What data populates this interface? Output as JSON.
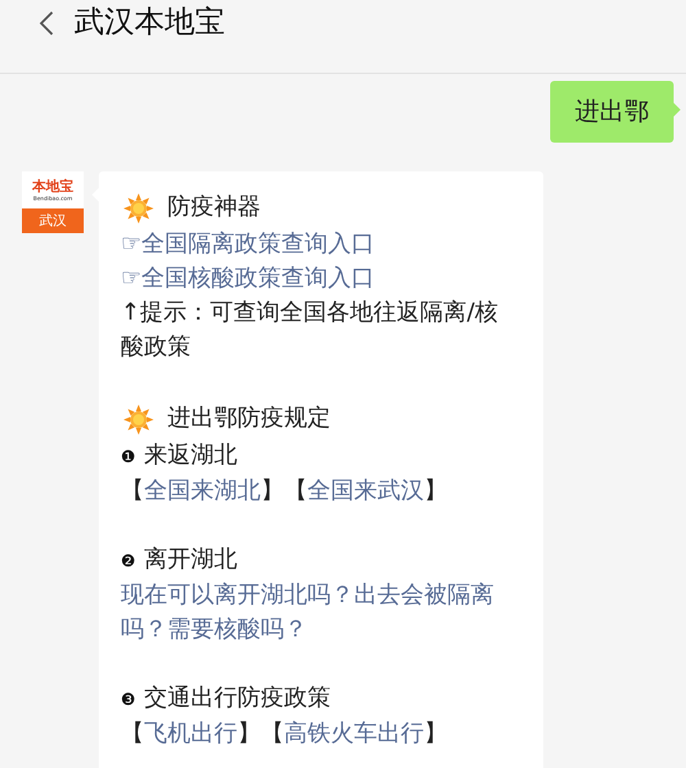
{
  "header": {
    "title": "武汉本地宝"
  },
  "messages": [
    {
      "kind": "outgoing",
      "text": "进出鄂"
    },
    {
      "kind": "incoming",
      "avatar": {
        "brand": "本地宝",
        "site": "Bendibao.com",
        "city": "武汉"
      },
      "blocks": [
        {
          "kind": "heading",
          "text": "防疫神器"
        },
        {
          "kind": "link",
          "text": "☞全国隔离政策查询入口"
        },
        {
          "kind": "link",
          "text": "☞全国核酸政策查询入口"
        },
        {
          "kind": "note",
          "text": "↑提示：可查询全国各地往返隔离/核酸政策"
        },
        {
          "kind": "spacer"
        },
        {
          "kind": "heading",
          "text": "进出鄂防疫规定"
        },
        {
          "kind": "section",
          "marker": "❶",
          "text": "来返湖北"
        },
        {
          "kind": "linkrow",
          "parts": [
            {
              "text": "【",
              "link": false
            },
            {
              "text": "全国来湖北",
              "link": true
            },
            {
              "text": "】【",
              "link": false
            },
            {
              "text": "全国来武汉",
              "link": true
            },
            {
              "text": "】",
              "link": false
            }
          ]
        },
        {
          "kind": "spacer"
        },
        {
          "kind": "section",
          "marker": "❷",
          "text": "离开湖北"
        },
        {
          "kind": "link",
          "text": "现在可以离开湖北吗？出去会被隔离吗？需要核酸吗？"
        },
        {
          "kind": "spacer"
        },
        {
          "kind": "section",
          "marker": "❸",
          "text": "交通出行防疫政策"
        },
        {
          "kind": "linkrow",
          "parts": [
            {
              "text": "【",
              "link": false
            },
            {
              "text": "飞机出行",
              "link": true
            },
            {
              "text": "】【",
              "link": false
            },
            {
              "text": "高铁火车出行",
              "link": true
            },
            {
              "text": "】",
              "link": false
            }
          ]
        }
      ]
    }
  ]
}
